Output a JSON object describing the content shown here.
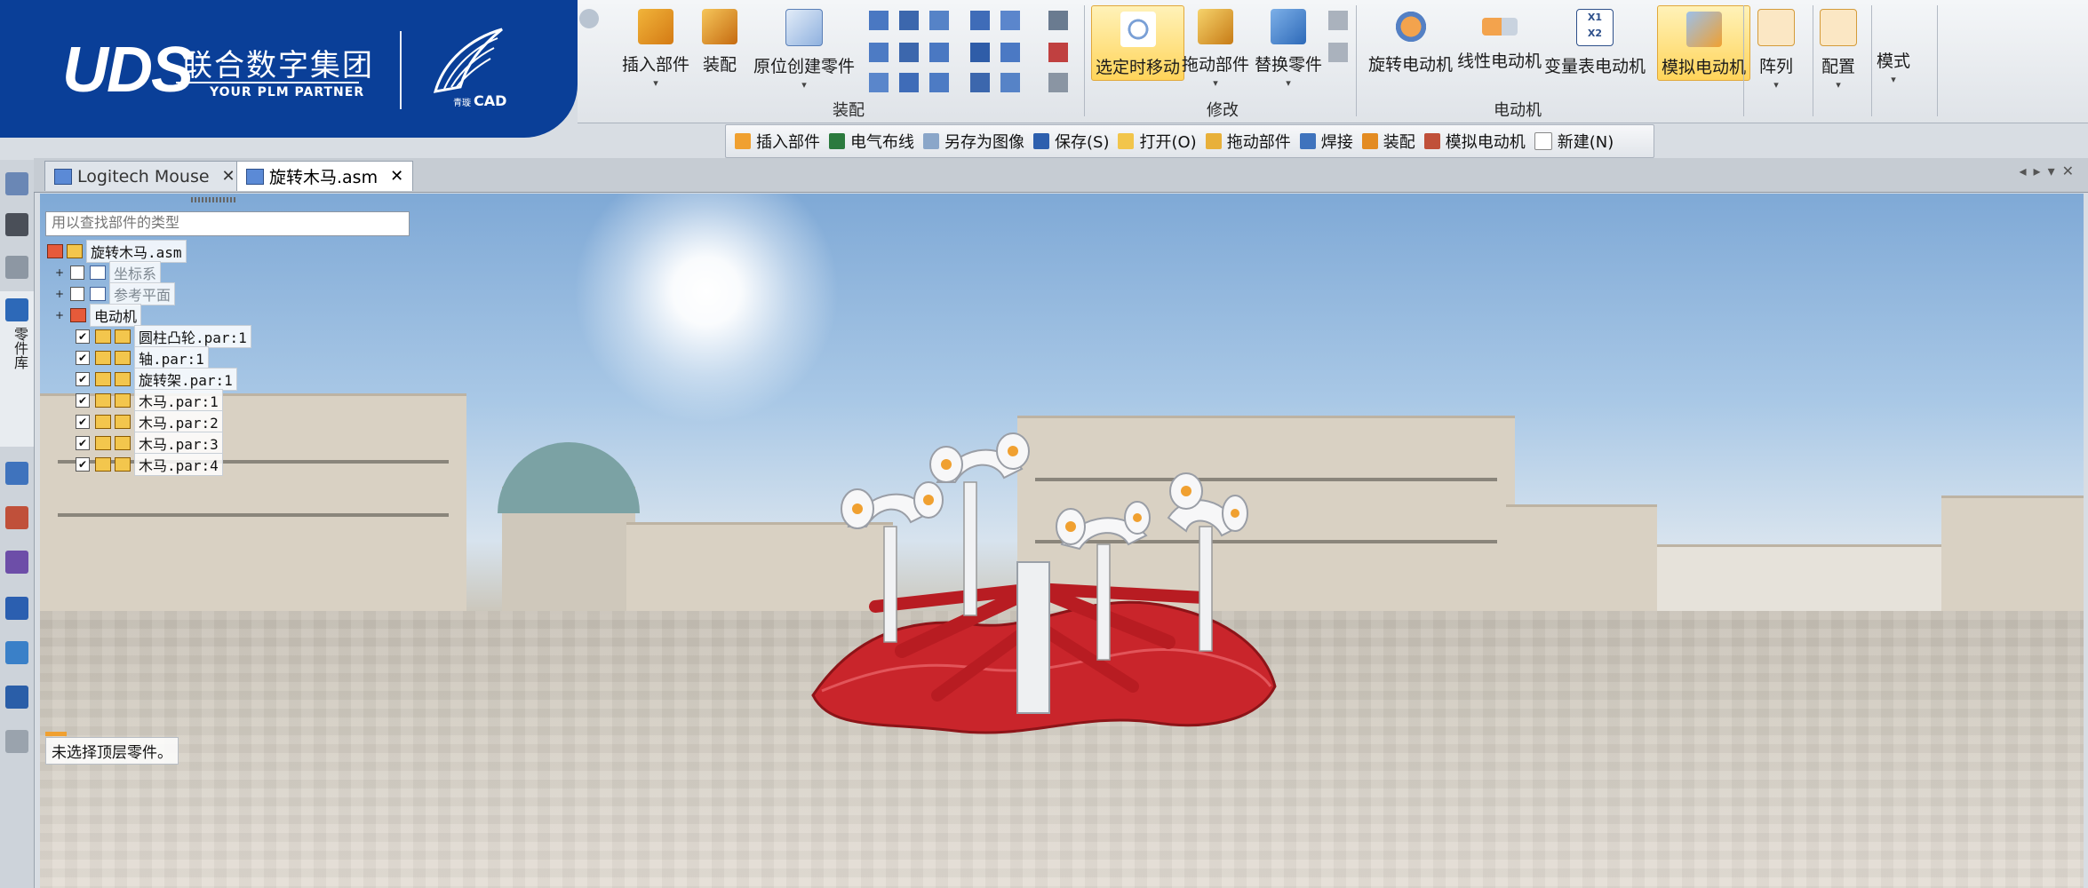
{
  "brand": {
    "logo_text": "UDS",
    "company_cn": "联合数字集团",
    "tagline": "YOUR PLM PARTNER",
    "product_prefix": "青璇",
    "product": "CAD",
    "brand_color": "#0a3f98"
  },
  "ribbon": {
    "groups": [
      {
        "label": "装配",
        "buttons": [
          "插入部件",
          "装配",
          "原位创建零件"
        ]
      },
      {
        "label": "修改",
        "buttons": [
          "选定时移动",
          "拖动部件",
          "替换零件"
        ]
      },
      {
        "label": "电动机",
        "buttons": [
          "旋转电动机",
          "线性电动机",
          "变量表电动机",
          "模拟电动机"
        ]
      }
    ],
    "extra_buttons": [
      "阵列",
      "配置",
      "模式"
    ],
    "active_color": "#ffd45a"
  },
  "quickbar": {
    "items": [
      "插入部件",
      "电气布线",
      "另存为图像",
      "保存(S)",
      "打开(O)",
      "拖动部件",
      "焊接",
      "装配",
      "模拟电动机",
      "新建(N)"
    ]
  },
  "sidebar": {
    "tab_label": "零件库"
  },
  "tabs": [
    {
      "label": "Logitech Mouse",
      "close": "✕"
    },
    {
      "label": "旋转木马.asm",
      "close": "✕"
    }
  ],
  "tree": {
    "search_placeholder": "用以查找部件的类型",
    "root": "旋转木马.asm",
    "nodes": [
      {
        "label": "坐标系",
        "expander": "+",
        "checked": ""
      },
      {
        "label": "参考平面",
        "expander": "+",
        "checked": ""
      },
      {
        "label": "电动机",
        "expander": "+",
        "checked": null
      }
    ],
    "parts": [
      {
        "label": "圆柱凸轮.par:1",
        "checked": "✔"
      },
      {
        "label": "轴.par:1",
        "checked": "✔"
      },
      {
        "label": "旋转架.par:1",
        "checked": "✔"
      },
      {
        "label": "木马.par:1",
        "checked": "✔"
      },
      {
        "label": "木马.par:2",
        "checked": "✔"
      },
      {
        "label": "木马.par:3",
        "checked": "✔"
      },
      {
        "label": "木马.par:4",
        "checked": "✔"
      }
    ]
  },
  "status": {
    "text": "未选择顶层零件。"
  }
}
